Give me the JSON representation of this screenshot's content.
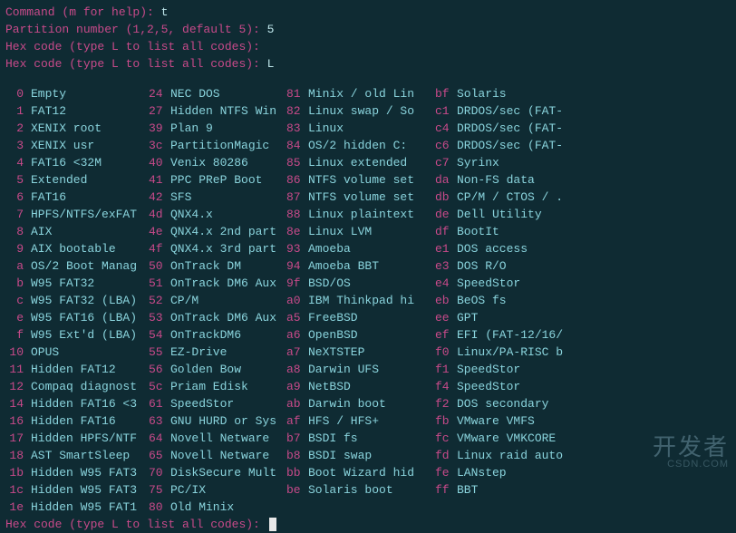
{
  "prompts": {
    "cmd_label": "Command (m for help): ",
    "cmd_input": "t",
    "part_label": "Partition number (1,2,5, default 5): ",
    "part_input": "5",
    "hex_label": "Hex code (type L to list all codes): ",
    "hex_input1": "",
    "hex_input2": "L",
    "hex_final": ""
  },
  "table": [
    {
      "c1": "0",
      "n1": "Empty",
      "c2": "24",
      "n2": "NEC DOS",
      "c3": "81",
      "n3": "Minix / old Lin",
      "c4": "bf",
      "n4": "Solaris"
    },
    {
      "c1": "1",
      "n1": "FAT12",
      "c2": "27",
      "n2": "Hidden NTFS Win",
      "c3": "82",
      "n3": "Linux swap / So",
      "c4": "c1",
      "n4": "DRDOS/sec (FAT-"
    },
    {
      "c1": "2",
      "n1": "XENIX root",
      "c2": "39",
      "n2": "Plan 9",
      "c3": "83",
      "n3": "Linux",
      "c4": "c4",
      "n4": "DRDOS/sec (FAT-"
    },
    {
      "c1": "3",
      "n1": "XENIX usr",
      "c2": "3c",
      "n2": "PartitionMagic",
      "c3": "84",
      "n3": "OS/2 hidden C:",
      "c4": "c6",
      "n4": "DRDOS/sec (FAT-"
    },
    {
      "c1": "4",
      "n1": "FAT16 <32M",
      "c2": "40",
      "n2": "Venix 80286",
      "c3": "85",
      "n3": "Linux extended",
      "c4": "c7",
      "n4": "Syrinx"
    },
    {
      "c1": "5",
      "n1": "Extended",
      "c2": "41",
      "n2": "PPC PReP Boot",
      "c3": "86",
      "n3": "NTFS volume set",
      "c4": "da",
      "n4": "Non-FS data"
    },
    {
      "c1": "6",
      "n1": "FAT16",
      "c2": "42",
      "n2": "SFS",
      "c3": "87",
      "n3": "NTFS volume set",
      "c4": "db",
      "n4": "CP/M / CTOS / ."
    },
    {
      "c1": "7",
      "n1": "HPFS/NTFS/exFAT",
      "c2": "4d",
      "n2": "QNX4.x",
      "c3": "88",
      "n3": "Linux plaintext",
      "c4": "de",
      "n4": "Dell Utility"
    },
    {
      "c1": "8",
      "n1": "AIX",
      "c2": "4e",
      "n2": "QNX4.x 2nd part",
      "c3": "8e",
      "n3": "Linux LVM",
      "c4": "df",
      "n4": "BootIt"
    },
    {
      "c1": "9",
      "n1": "AIX bootable",
      "c2": "4f",
      "n2": "QNX4.x 3rd part",
      "c3": "93",
      "n3": "Amoeba",
      "c4": "e1",
      "n4": "DOS access"
    },
    {
      "c1": "a",
      "n1": "OS/2 Boot Manag",
      "c2": "50",
      "n2": "OnTrack DM",
      "c3": "94",
      "n3": "Amoeba BBT",
      "c4": "e3",
      "n4": "DOS R/O"
    },
    {
      "c1": "b",
      "n1": "W95 FAT32",
      "c2": "51",
      "n2": "OnTrack DM6 Aux",
      "c3": "9f",
      "n3": "BSD/OS",
      "c4": "e4",
      "n4": "SpeedStor"
    },
    {
      "c1": "c",
      "n1": "W95 FAT32 (LBA)",
      "c2": "52",
      "n2": "CP/M",
      "c3": "a0",
      "n3": "IBM Thinkpad hi",
      "c4": "eb",
      "n4": "BeOS fs"
    },
    {
      "c1": "e",
      "n1": "W95 FAT16 (LBA)",
      "c2": "53",
      "n2": "OnTrack DM6 Aux",
      "c3": "a5",
      "n3": "FreeBSD",
      "c4": "ee",
      "n4": "GPT"
    },
    {
      "c1": "f",
      "n1": "W95 Ext'd (LBA)",
      "c2": "54",
      "n2": "OnTrackDM6",
      "c3": "a6",
      "n3": "OpenBSD",
      "c4": "ef",
      "n4": "EFI (FAT-12/16/"
    },
    {
      "c1": "10",
      "n1": "OPUS",
      "c2": "55",
      "n2": "EZ-Drive",
      "c3": "a7",
      "n3": "NeXTSTEP",
      "c4": "f0",
      "n4": "Linux/PA-RISC b"
    },
    {
      "c1": "11",
      "n1": "Hidden FAT12",
      "c2": "56",
      "n2": "Golden Bow",
      "c3": "a8",
      "n3": "Darwin UFS",
      "c4": "f1",
      "n4": "SpeedStor"
    },
    {
      "c1": "12",
      "n1": "Compaq diagnost",
      "c2": "5c",
      "n2": "Priam Edisk",
      "c3": "a9",
      "n3": "NetBSD",
      "c4": "f4",
      "n4": "SpeedStor"
    },
    {
      "c1": "14",
      "n1": "Hidden FAT16 <3",
      "c2": "61",
      "n2": "SpeedStor",
      "c3": "ab",
      "n3": "Darwin boot",
      "c4": "f2",
      "n4": "DOS secondary"
    },
    {
      "c1": "16",
      "n1": "Hidden FAT16",
      "c2": "63",
      "n2": "GNU HURD or Sys",
      "c3": "af",
      "n3": "HFS / HFS+",
      "c4": "fb",
      "n4": "VMware VMFS"
    },
    {
      "c1": "17",
      "n1": "Hidden HPFS/NTF",
      "c2": "64",
      "n2": "Novell Netware",
      "c3": "b7",
      "n3": "BSDI fs",
      "c4": "fc",
      "n4": "VMware VMKCORE"
    },
    {
      "c1": "18",
      "n1": "AST SmartSleep",
      "c2": "65",
      "n2": "Novell Netware",
      "c3": "b8",
      "n3": "BSDI swap",
      "c4": "fd",
      "n4": "Linux raid auto"
    },
    {
      "c1": "1b",
      "n1": "Hidden W95 FAT3",
      "c2": "70",
      "n2": "DiskSecure Mult",
      "c3": "bb",
      "n3": "Boot Wizard hid",
      "c4": "fe",
      "n4": "LANstep"
    },
    {
      "c1": "1c",
      "n1": "Hidden W95 FAT3",
      "c2": "75",
      "n2": "PC/IX",
      "c3": "be",
      "n3": "Solaris boot",
      "c4": "ff",
      "n4": "BBT"
    },
    {
      "c1": "1e",
      "n1": "Hidden W95 FAT1",
      "c2": "80",
      "n2": "Old Minix",
      "c3": "",
      "n3": "",
      "c4": "",
      "n4": ""
    }
  ],
  "watermark": {
    "main": "开发者",
    "sub": "CSDN.COM"
  }
}
